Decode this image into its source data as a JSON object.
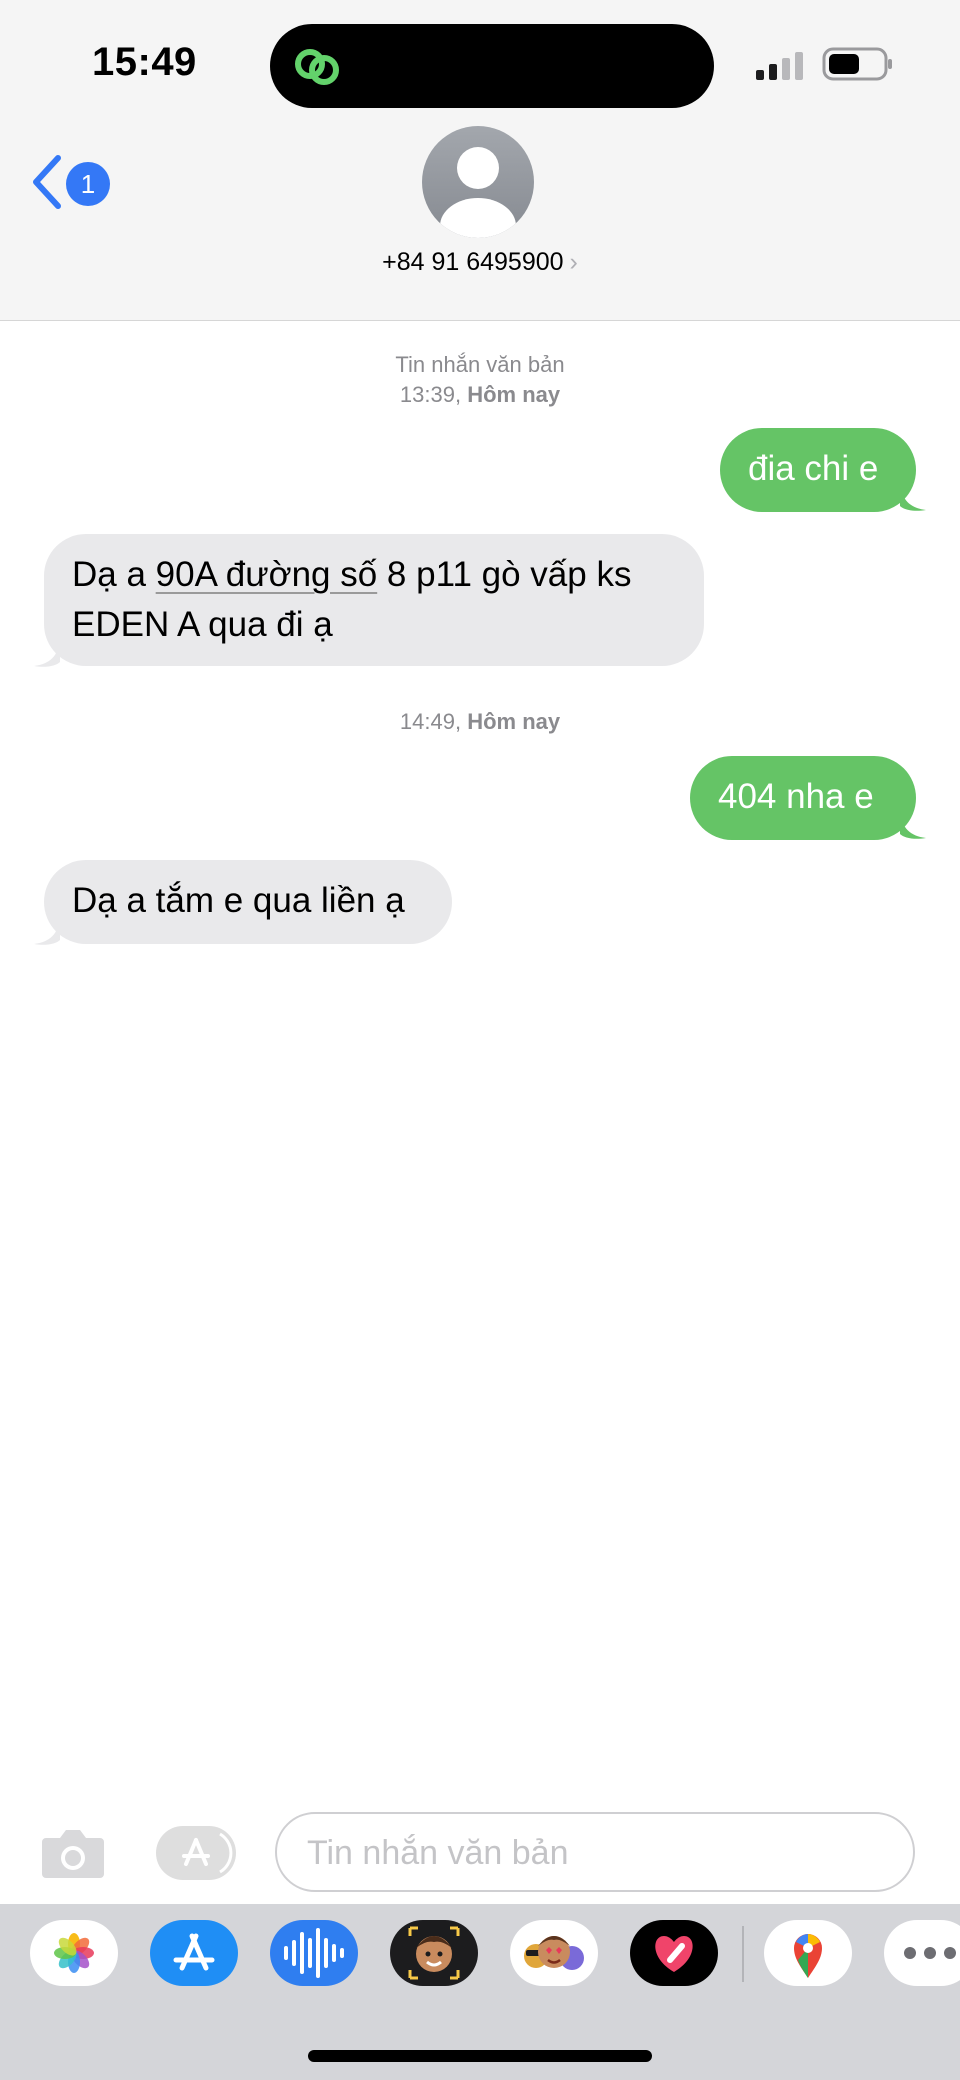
{
  "status_bar": {
    "time": "15:49",
    "icons": [
      "link-activity-icon",
      "cellular-signal-icon",
      "battery-icon"
    ]
  },
  "header": {
    "back_badge": "1",
    "contact": "+84 91 6495900",
    "chevron": "›"
  },
  "conversation": {
    "service_label": "Tin nhắn văn bản",
    "timestamp_1": {
      "time": "13:39,",
      "day": "Hôm nay"
    },
    "timestamp_2": {
      "time": "14:49,",
      "day": "Hôm nay"
    },
    "messages": [
      {
        "direction": "outgoing",
        "text": "đia chi e"
      },
      {
        "direction": "incoming",
        "text_parts": [
          "Dạ a ",
          "90A đường số",
          " 8 p11 gò vấp ks",
          "EDEN A qua đi ạ"
        ]
      },
      {
        "direction": "outgoing",
        "text": "404 nha e"
      },
      {
        "direction": "incoming",
        "text": "Dạ a tắm e qua liền ạ"
      }
    ]
  },
  "composer": {
    "placeholder": "Tin nhắn văn bản",
    "value": ""
  },
  "app_tray": {
    "apps": [
      "photos-icon",
      "app-store-icon",
      "audio-message-icon",
      "memoji-icon",
      "memoji-stickers-icon",
      "digital-touch-icon",
      "google-maps-icon",
      "more-icon"
    ]
  },
  "colors": {
    "outgoing_bubble": "#65c466",
    "incoming_bubble": "#e9e9eb",
    "accent": "#3478f6"
  }
}
